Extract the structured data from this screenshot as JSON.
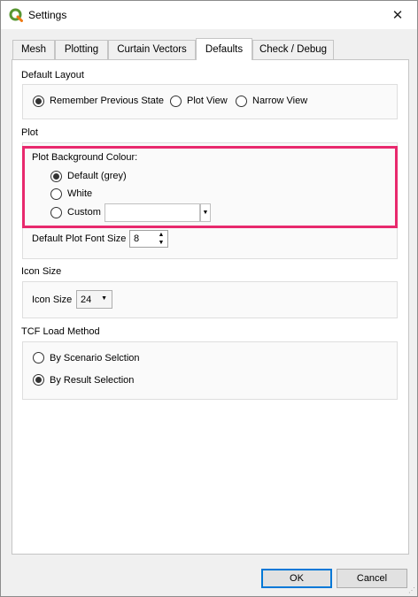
{
  "window": {
    "title": "Settings"
  },
  "tabs": [
    {
      "label": "Mesh"
    },
    {
      "label": "Plotting"
    },
    {
      "label": "Curtain Vectors"
    },
    {
      "label": "Defaults"
    },
    {
      "label": "Check / Debug"
    }
  ],
  "default_layout": {
    "title": "Default Layout",
    "options": [
      "Remember Previous State",
      "Plot View",
      "Narrow View"
    ],
    "selected": "Remember Previous State"
  },
  "plot": {
    "title": "Plot",
    "background_colour": {
      "title": "Plot Background Colour:",
      "options": [
        "Default (grey)",
        "White",
        "Custom"
      ],
      "selected": "Default (grey)",
      "custom_value": ""
    },
    "font_size_label": "Default Plot Font Size",
    "font_size_value": "8"
  },
  "icon_size": {
    "title": "Icon Size",
    "label": "Icon Size",
    "value": "24"
  },
  "tcf_load": {
    "title": "TCF Load Method",
    "options": [
      "By Scenario Selction",
      "By Result Selection"
    ],
    "selected": "By Result Selection"
  },
  "buttons": {
    "ok": "OK",
    "cancel": "Cancel"
  },
  "colors": {
    "highlight": "#e8296d",
    "qgis_green": "#589632",
    "accent": "#0078d7"
  }
}
